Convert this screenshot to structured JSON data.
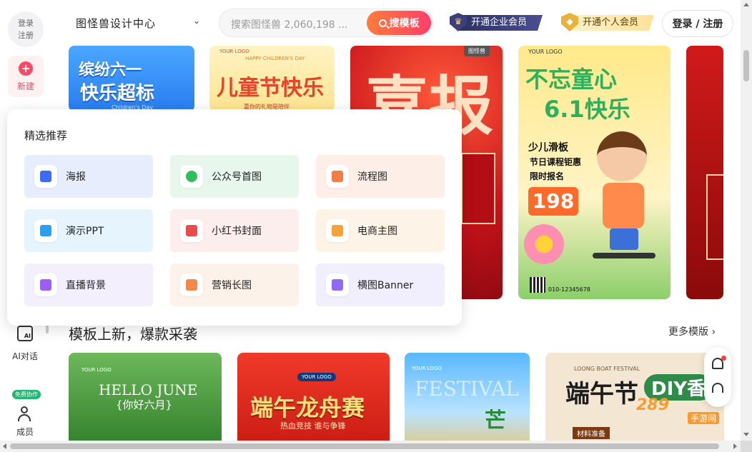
{
  "sidebar": {
    "login_line1": "登录",
    "login_line2": "注册",
    "new_label": "新建",
    "ai_label": "AI对话",
    "ai_icon_text": "AI",
    "free_badge": "免费协作",
    "member_label": "成员"
  },
  "header": {
    "brand": "图怪兽设计中心",
    "search_placeholder": "搜索图怪兽 2,060,198 ...",
    "search_button": "搜模板",
    "enterprise_vip": "开通企业会员",
    "personal_vip": "开通个人会员",
    "login_register": "登录 / 注册"
  },
  "cards_top": {
    "c1_line1": "缤纷六一",
    "c1_line2": "快乐超标",
    "c1_en": "Children's Day",
    "c2_logo": "YOUR LOGO",
    "c2_en": "HAPPY CHILDREN'S DAY",
    "c2_title": "儿童节快乐",
    "c2_sub": "嘉你的礼物是陪伴",
    "c3_title": "喜报",
    "c3_tag": "图怪兽",
    "c4_logo": "YOUR LOGO",
    "c4_line1": "不忘童心",
    "c4_line2": "6.1快乐",
    "c4_s1": "少儿滑板",
    "c4_s2": "节日课程钜惠",
    "c4_s3": "限时报名",
    "c4_price": "198",
    "c4_phone": "010-12345678"
  },
  "popup": {
    "title": "精选推荐",
    "items": [
      {
        "label": "海报",
        "bg": "#e8edfd",
        "icon_color": "#3b6cf6"
      },
      {
        "label": "公众号首图",
        "bg": "#e8f7ec",
        "icon_color": "#2fbf5a"
      },
      {
        "label": "流程图",
        "bg": "#fdeee8",
        "icon_color": "#f37d4a"
      },
      {
        "label": "演示PPT",
        "bg": "#e6f4fd",
        "icon_color": "#2c9ff0"
      },
      {
        "label": "小红书封面",
        "bg": "#fdeeee",
        "icon_color": "#e74b4b"
      },
      {
        "label": "电商主图",
        "bg": "#fdf3e6",
        "icon_color": "#f5a23a"
      },
      {
        "label": "直播背景",
        "bg": "#f3effd",
        "icon_color": "#9b5df5"
      },
      {
        "label": "营销长图",
        "bg": "#fdf2ea",
        "icon_color": "#f3884a"
      },
      {
        "label": "横图Banner",
        "bg": "#f1effd",
        "icon_color": "#8e6af5"
      }
    ]
  },
  "section": {
    "title": "模板上新，爆款采袭",
    "more": "更多模版"
  },
  "cards_bottom": {
    "b1_logo": "YOUR LOGO",
    "b1_title": "HELLO JUNE",
    "b1_sub": "{你好六月}",
    "b2_logo": "YOUR LOGO",
    "b2_title": "端午龙舟赛",
    "b2_sub": "热血竞技 谁与争锋",
    "b3_logo": "YOUR LOGO",
    "b3_title": "FESTIVAL",
    "b3_char": "芒",
    "b4_en": "LOONG BOAT FESTIVAL",
    "b4_title": "端午节",
    "b4_diy": "DIY香",
    "b4_tag": "材料准备"
  },
  "watermark": {
    "text": "289",
    "sub": "手游网"
  }
}
